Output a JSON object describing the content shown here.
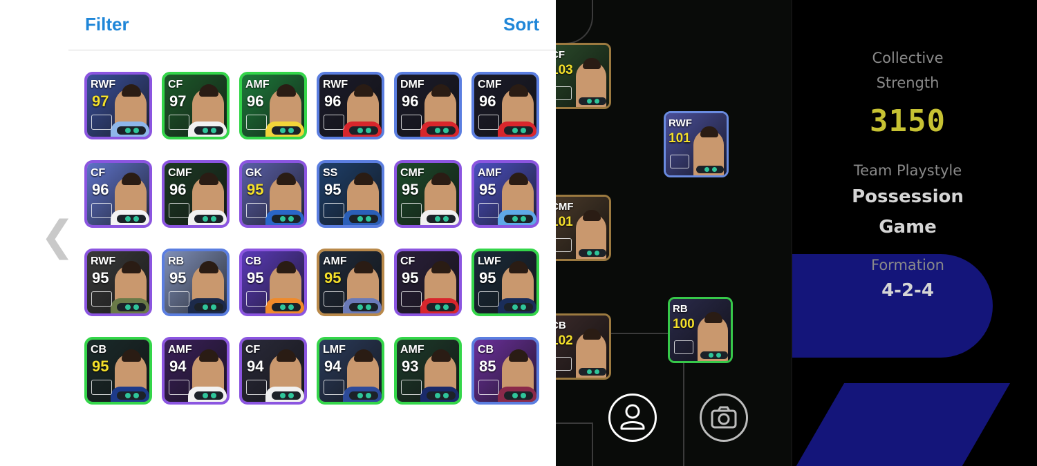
{
  "header": {
    "filter_label": "Filter",
    "sort_label": "Sort"
  },
  "navigation": {
    "back_icon": "chevron-left-icon",
    "back_glyph": "❮"
  },
  "player_list": [
    {
      "position": "RWF",
      "rating": "97",
      "rating_color": "gold",
      "border": "purple",
      "bg": "#3a4f9a",
      "jersey": "#8fb7ea",
      "badge": "argentina-flag"
    },
    {
      "position": "CF",
      "rating": "97",
      "rating_color": "white",
      "border": "green",
      "bg": "#1d5a2a",
      "jersey": "#f1f1f1",
      "badge": "club-crest"
    },
    {
      "position": "AMF",
      "rating": "96",
      "rating_color": "white",
      "border": "green",
      "bg": "#1d7a3a",
      "jersey": "#f2d43a",
      "badge": "brazil-flag"
    },
    {
      "position": "RWF",
      "rating": "96",
      "rating_color": "white",
      "border": "blue",
      "bg": "#1b1b2a",
      "jersey": "#d8262c",
      "badge": "arsenal-crest"
    },
    {
      "position": "DMF",
      "rating": "96",
      "rating_color": "white",
      "border": "blue",
      "bg": "#1b1b2a",
      "jersey": "#d8262c",
      "badge": "arsenal-crest"
    },
    {
      "position": "CMF",
      "rating": "96",
      "rating_color": "white",
      "border": "blue",
      "bg": "#1b1b2a",
      "jersey": "#d8262c",
      "badge": "arsenal-crest"
    },
    {
      "position": "CF",
      "rating": "96",
      "rating_color": "white",
      "border": "purple",
      "bg": "#5e72c8",
      "jersey": "#f4f4f4",
      "badge": "england-flag"
    },
    {
      "position": "CMF",
      "rating": "96",
      "rating_color": "white",
      "border": "purple",
      "bg": "#1d3a24",
      "jersey": "#f1f1f1",
      "badge": "club-crest"
    },
    {
      "position": "GK",
      "rating": "95",
      "rating_color": "gold",
      "border": "purple",
      "bg": "#5a5fa8",
      "jersey": "#2a66c8",
      "badge": "club-crest"
    },
    {
      "position": "SS",
      "rating": "95",
      "rating_color": "white",
      "border": "blue",
      "bg": "#1e3f6a",
      "jersey": "#2b5fb8",
      "badge": "brazil-flag"
    },
    {
      "position": "CMF",
      "rating": "95",
      "rating_color": "white",
      "border": "purple",
      "bg": "#1d4a2a",
      "jersey": "#f1f1f1",
      "badge": "club-crest"
    },
    {
      "position": "AMF",
      "rating": "95",
      "rating_color": "white",
      "border": "purple",
      "bg": "#4b4fc0",
      "jersey": "#5fa8e8",
      "badge": "club-crest"
    },
    {
      "position": "RWF",
      "rating": "95",
      "rating_color": "white",
      "border": "purple",
      "bg": "#3a3a3a",
      "jersey": "#6a7a48",
      "badge": "spain-flag"
    },
    {
      "position": "RB",
      "rating": "95",
      "rating_color": "white",
      "border": "blue",
      "bg": "#7f8fb8",
      "jersey": "#1c2a4a",
      "badge": "england-flag"
    },
    {
      "position": "CB",
      "rating": "95",
      "rating_color": "white",
      "border": "purple",
      "bg": "#5a3ab8",
      "jersey": "#f08a2a",
      "badge": "netherlands-flag"
    },
    {
      "position": "AMF",
      "rating": "95",
      "rating_color": "gold",
      "border": "gold",
      "bg": "#1f2a3a",
      "jersey": "#6a7ab8",
      "badge": "club-crest"
    },
    {
      "position": "CF",
      "rating": "95",
      "rating_color": "white",
      "border": "purple",
      "bg": "#2a1f3a",
      "jersey": "#d8262c",
      "badge": "arsenal-crest"
    },
    {
      "position": "LWF",
      "rating": "95",
      "rating_color": "white",
      "border": "green",
      "bg": "#1a2a3a",
      "jersey": "#1a2d5a",
      "badge": "psg-crest"
    },
    {
      "position": "CB",
      "rating": "95",
      "rating_color": "gold",
      "border": "green",
      "bg": "#1a2a2a",
      "jersey": "#1d3a8a",
      "badge": "inter-crest"
    },
    {
      "position": "AMF",
      "rating": "94",
      "rating_color": "white",
      "border": "purple",
      "bg": "#3a1f5a",
      "jersey": "#f2f2f2",
      "badge": "barcelona-crest"
    },
    {
      "position": "CF",
      "rating": "94",
      "rating_color": "white",
      "border": "purple",
      "bg": "#2a2a3a",
      "jersey": "#f1f1f1",
      "badge": "club-crest"
    },
    {
      "position": "LMF",
      "rating": "94",
      "rating_color": "white",
      "border": "green",
      "bg": "#2a3a5a",
      "jersey": "#2d4a9a",
      "badge": "inter-crest"
    },
    {
      "position": "AMF",
      "rating": "93",
      "rating_color": "white",
      "border": "green",
      "bg": "#1d3a2a",
      "jersey": "#1a2a6a",
      "badge": "fenerbahce-crest"
    },
    {
      "position": "CB",
      "rating": "85",
      "rating_color": "white",
      "border": "blue",
      "bg": "#6a2f9a",
      "jersey": "#8a2a4a",
      "badge": "barcelona-crest"
    }
  ],
  "formation_cards": [
    {
      "position": "CF",
      "rating": "103",
      "border": "gold",
      "bg": "#2a4a2a"
    },
    {
      "position": "RWF",
      "rating": "101",
      "border": "blue",
      "bg": "#4a4f9a"
    },
    {
      "position": "CMF",
      "rating": "101",
      "border": "gold",
      "bg": "#4a3a2a"
    },
    {
      "position": "CB",
      "rating": "102",
      "border": "gold",
      "bg": "#3a2a2a"
    },
    {
      "position": "RB",
      "rating": "100",
      "border": "green",
      "bg": "#2a2a4a"
    }
  ],
  "actions": {
    "player_icon": "user-icon",
    "camera_icon": "camera-icon"
  },
  "team_stats": {
    "collective_strength_label_line1": "Collective",
    "collective_strength_label_line2": "Strength",
    "collective_strength_value": "3150",
    "playstyle_label": "Team Playstyle",
    "playstyle_value_line1": "Possession",
    "playstyle_value_line2": "Game",
    "formation_label": "Formation",
    "formation_value": "4-2-4"
  }
}
